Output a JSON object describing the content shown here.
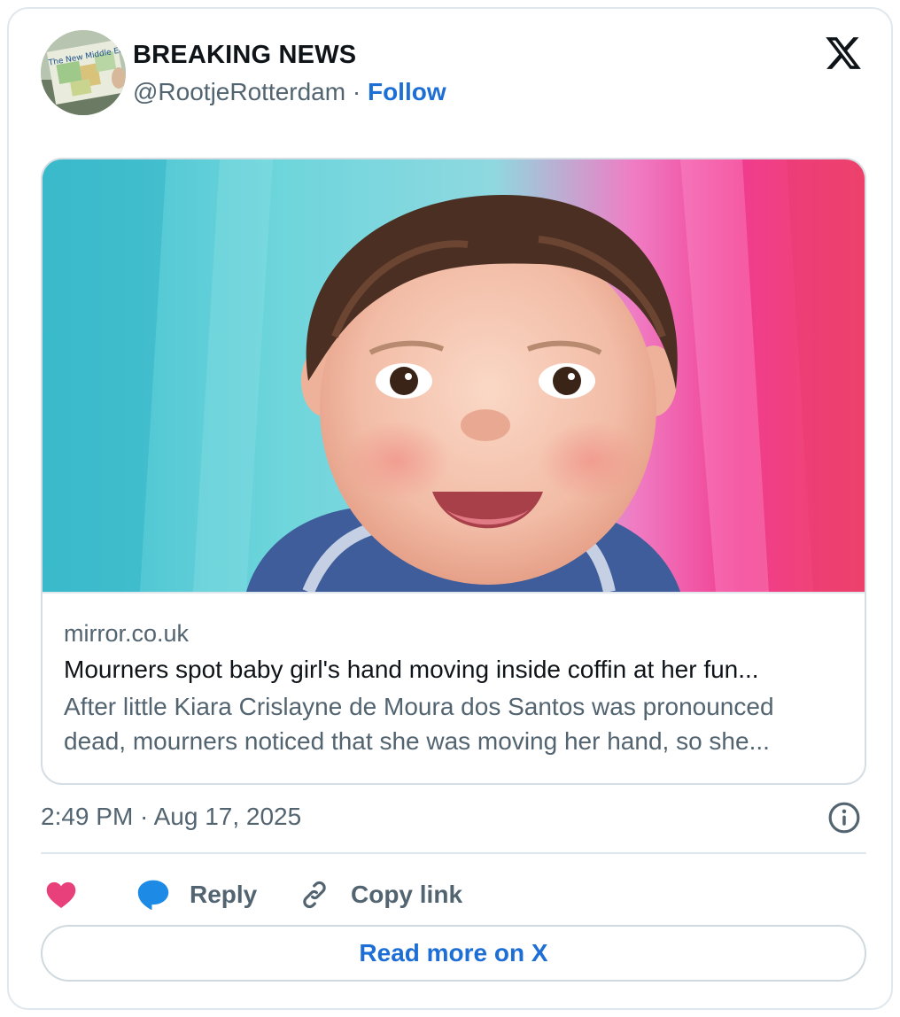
{
  "author": {
    "name": "BREAKING NEWS",
    "handle": "@RootjeRotterdam",
    "separator": " · ",
    "follow_label": "Follow",
    "avatar_text": "The New Middle East"
  },
  "link_preview": {
    "domain": "mirror.co.uk",
    "title": "Mourners spot baby girl's hand moving inside coffin at her fun...",
    "description_line1": "After little Kiara Crislayne de Moura dos Santos was pronounced",
    "description_line2": "dead, mourners noticed that she was moving her hand, so she..."
  },
  "timestamp": "2:49 PM · Aug 17, 2025",
  "actions": {
    "reply_label": "Reply",
    "copy_label": "Copy link"
  },
  "read_more_label": "Read more on X",
  "colors": {
    "accent": "#1d6fd6",
    "like": "#e8407a",
    "reply_icon": "#1d8ae6",
    "muted": "#536471"
  }
}
